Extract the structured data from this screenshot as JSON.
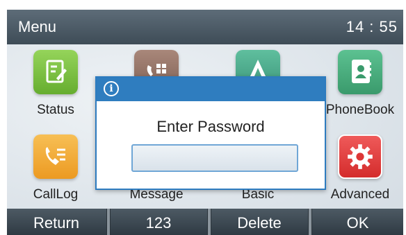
{
  "header": {
    "title": "Menu",
    "time": "14 : 55"
  },
  "apps": [
    {
      "label": "Status",
      "icon": "status-icon",
      "color": "#7cc142"
    },
    {
      "label": "",
      "icon": "directory-icon",
      "color": "#8a6a58"
    },
    {
      "label": "",
      "icon": "features-icon",
      "color": "#4aa58a"
    },
    {
      "label": "PhoneBook",
      "icon": "phonebook-icon",
      "color": "#41a679"
    },
    {
      "label": "CallLog",
      "icon": "calllog-icon",
      "color": "#f2a534"
    },
    {
      "label": "Message",
      "icon": "message-icon",
      "color": "#2f7dbf"
    },
    {
      "label": "Basic",
      "icon": "basic-icon",
      "color": "#3b7ad0"
    },
    {
      "label": "Advanced",
      "icon": "gear-icon",
      "color": "#e23b3b"
    }
  ],
  "dialog": {
    "icon": "info-icon",
    "prompt": "Enter Password",
    "password_value": ""
  },
  "softkeys": {
    "k1": "Return",
    "k2": "123",
    "k3": "Delete",
    "k4": "OK"
  },
  "colors": {
    "dialog_header": "#2f7dbf",
    "softkey_bar": "#3a4650",
    "topbar": "#4e5c67"
  }
}
